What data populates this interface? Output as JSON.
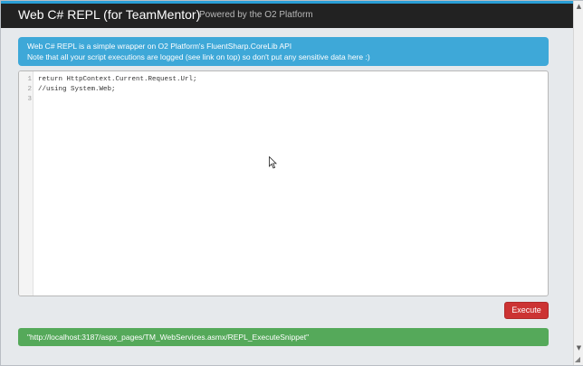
{
  "header": {
    "title": "Web C# REPL (for TeamMentor)",
    "subtitle": "Powered by the O2 Platform"
  },
  "info": {
    "line1": "Web C# REPL is a simple wrapper on O2 Platform's FluentSharp.CoreLib API",
    "line2": "Note that all your script executions are logged (see link on top) so don't put any sensitive data here :)"
  },
  "editor": {
    "lines": [
      {
        "number": "1",
        "code": "return HttpContext.Current.Request.Url;"
      },
      {
        "number": "2",
        "code": "//using System.Web;"
      },
      {
        "number": "3",
        "code": ""
      }
    ]
  },
  "actions": {
    "execute_label": "Execute"
  },
  "result": {
    "text": "\"http://localhost:3187/aspx_pages/TM_WebServices.asmx/REPL_ExecuteSnippet\""
  },
  "colors": {
    "topbar": "#222222",
    "accent": "#2a9fd6",
    "info": "#3ea8d8",
    "execute": "#cc3333",
    "success": "#55a95a"
  },
  "icons": {
    "cursor": "mouse-pointer-icon",
    "scroll_up": "scroll-up-arrow-icon",
    "scroll_down": "scroll-down-arrow-icon",
    "resize": "resize-grip-icon"
  }
}
